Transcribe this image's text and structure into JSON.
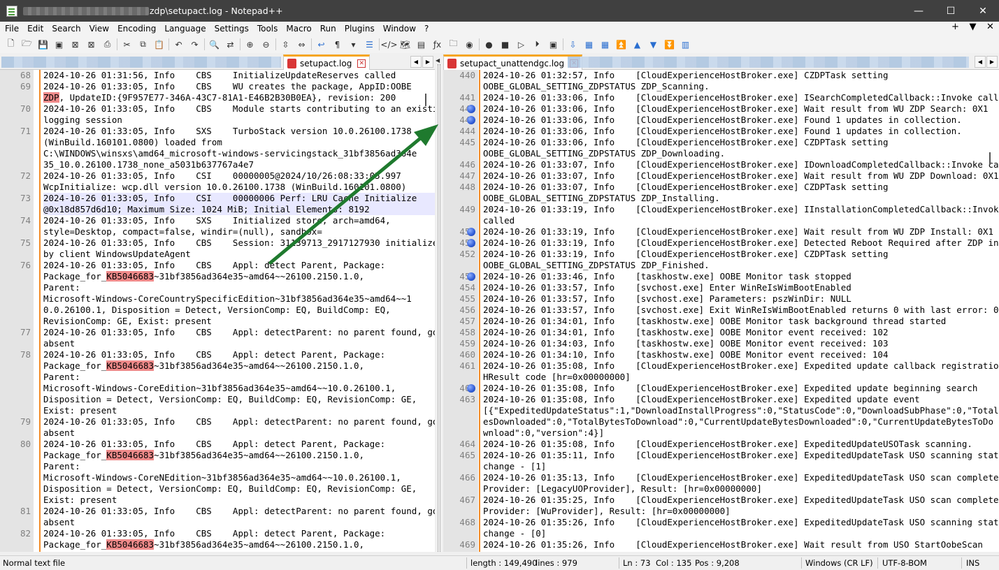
{
  "window": {
    "title": "zdp\\setupact.log - Notepad++",
    "minimize": "—",
    "maximize": "☐",
    "close": "✕"
  },
  "menu": [
    "File",
    "Edit",
    "Search",
    "View",
    "Encoding",
    "Language",
    "Settings",
    "Tools",
    "Macro",
    "Run",
    "Plugins",
    "Window",
    "?"
  ],
  "menu_right": [
    "+",
    "▼",
    "✕"
  ],
  "left_tab": {
    "label": "setupact.log",
    "close": "✕"
  },
  "right_tab": {
    "label": "setupact_unattendgc.log",
    "close": "✕"
  },
  "left_lines": [
    {
      "n": "68",
      "t": "2024-10-26 01:31:56, Info    CBS    InitializeUpdateReserves called"
    },
    {
      "n": "69",
      "t": "2024-10-26 01:33:05, Info    CBS    WU creates the package, AppID:OOBE"
    },
    {
      "n": "",
      "t": "ZDP, UpdateID:{9F957E77-346A-43C7-81A1-E46B2B30B0EA}, revision: 200",
      "hl": "ZDP"
    },
    {
      "n": "70",
      "t": "2024-10-26 01:33:05, Info    CBS    Module starts contributing to an existing"
    },
    {
      "n": "",
      "t": "logging session"
    },
    {
      "n": "71",
      "t": "2024-10-26 01:33:05, Info    SXS    TurboStack version 10.0.26100.1738"
    },
    {
      "n": "",
      "t": "(WinBuild.160101.0800) loaded from"
    },
    {
      "n": "",
      "t": "C:\\WINDOWS\\winsxs\\amd64_microsoft-windows-servicingstack_31bf3856ad364e"
    },
    {
      "n": "",
      "t": "35_10.0.26100.1738_none_a5031b637767a4e7"
    },
    {
      "n": "72",
      "t": "2024-10-26 01:33:05, Info    CSI    00000005@2024/10/26:08:33:05.997"
    },
    {
      "n": "",
      "t": "WcpInitialize: wcp.dll version 10.0.26100.1738 (WinBuild.160101.0800)"
    },
    {
      "n": "73",
      "t": "2024-10-26 01:33:05, Info    CSI    00000006 Perf: LRU Cache Initialize",
      "cur": true
    },
    {
      "n": "",
      "t": "@0x18d857d6d10; Maximum Size: 1024 MiB; Initial Elements: 8192",
      "cur": true
    },
    {
      "n": "74",
      "t": "2024-10-26 01:33:05, Info    SXS    Initialized store, arch=amd64,"
    },
    {
      "n": "",
      "t": "style=Desktop, compact=false, windir=(null), sandbox="
    },
    {
      "n": "75",
      "t": "2024-10-26 01:33:05, Info    CBS    Session: 31139713_2917127930 initialized"
    },
    {
      "n": "",
      "t": "by client WindowsUpdateAgent"
    },
    {
      "n": "76",
      "t": "2024-10-26 01:33:05, Info    CBS    Appl: detect Parent, Package:"
    },
    {
      "n": "",
      "t": "Package_for_KB5046683~31bf3856ad364e35~amd64~~26100.2150.1.0,",
      "hl": "KB5046683"
    },
    {
      "n": "",
      "t": "Parent:"
    },
    {
      "n": "",
      "t": "Microsoft-Windows-CoreCountrySpecificEdition~31bf3856ad364e35~amd64~~1"
    },
    {
      "n": "",
      "t": "0.0.26100.1, Disposition = Detect, VersionComp: EQ, BuildComp: EQ,"
    },
    {
      "n": "",
      "t": "RevisionComp: GE, Exist: present"
    },
    {
      "n": "77",
      "t": "2024-10-26 01:33:05, Info    CBS    Appl: detectParent: no parent found, go"
    },
    {
      "n": "",
      "t": "absent"
    },
    {
      "n": "78",
      "t": "2024-10-26 01:33:05, Info    CBS    Appl: detect Parent, Package:"
    },
    {
      "n": "",
      "t": "Package_for_KB5046683~31bf3856ad364e35~amd64~~26100.2150.1.0,",
      "hl": "KB5046683"
    },
    {
      "n": "",
      "t": "Parent:"
    },
    {
      "n": "",
      "t": "Microsoft-Windows-CoreEdition~31bf3856ad364e35~amd64~~10.0.26100.1,"
    },
    {
      "n": "",
      "t": "Disposition = Detect, VersionComp: EQ, BuildComp: EQ, RevisionComp: GE,"
    },
    {
      "n": "",
      "t": "Exist: present"
    },
    {
      "n": "79",
      "t": "2024-10-26 01:33:05, Info    CBS    Appl: detectParent: no parent found, go"
    },
    {
      "n": "",
      "t": "absent"
    },
    {
      "n": "80",
      "t": "2024-10-26 01:33:05, Info    CBS    Appl: detect Parent, Package:"
    },
    {
      "n": "",
      "t": "Package_for_KB5046683~31bf3856ad364e35~amd64~~26100.2150.1.0,",
      "hl": "KB5046683"
    },
    {
      "n": "",
      "t": "Parent:"
    },
    {
      "n": "",
      "t": "Microsoft-Windows-CoreNEdition~31bf3856ad364e35~amd64~~10.0.26100.1,"
    },
    {
      "n": "",
      "t": "Disposition = Detect, VersionComp: EQ, BuildComp: EQ, RevisionComp: GE,"
    },
    {
      "n": "",
      "t": "Exist: present"
    },
    {
      "n": "81",
      "t": "2024-10-26 01:33:05, Info    CBS    Appl: detectParent: no parent found, go"
    },
    {
      "n": "",
      "t": "absent"
    },
    {
      "n": "82",
      "t": "2024-10-26 01:33:05, Info    CBS    Appl: detect Parent, Package:"
    },
    {
      "n": "",
      "t": "Package_for_KB5046683~31bf3856ad364e35~amd64~~26100.2150.1.0,",
      "hl": "KB5046683"
    }
  ],
  "right_lines": [
    {
      "n": "440",
      "t": "2024-10-26 01:32:57, Info    [CloudExperienceHostBroker.exe] CZDPTask setting"
    },
    {
      "n": "",
      "t": "OOBE_GLOBAL_SETTING_ZDPSTATUS ZDP_Scanning."
    },
    {
      "n": "441",
      "t": "2024-10-26 01:33:06, Info    [CloudExperienceHostBroker.exe] ISearchCompletedCallback::Invoke called"
    },
    {
      "n": "442",
      "t": "2024-10-26 01:33:06, Info    [CloudExperienceHostBroker.exe] Wait result from WU ZDP Search: 0X1",
      "bm": true
    },
    {
      "n": "443",
      "t": "2024-10-26 01:33:06, Info    [CloudExperienceHostBroker.exe] Found 1 updates in collection.",
      "bm": true
    },
    {
      "n": "444",
      "t": "2024-10-26 01:33:06, Info    [CloudExperienceHostBroker.exe] Found 1 updates in collection."
    },
    {
      "n": "445",
      "t": "2024-10-26 01:33:06, Info    [CloudExperienceHostBroker.exe] CZDPTask setting"
    },
    {
      "n": "",
      "t": "OOBE_GLOBAL_SETTING_ZDPSTATUS ZDP_Downloading."
    },
    {
      "n": "446",
      "t": "2024-10-26 01:33:07, Info    [CloudExperienceHostBroker.exe] IDownloadCompletedCallback::Invoke called"
    },
    {
      "n": "447",
      "t": "2024-10-26 01:33:07, Info    [CloudExperienceHostBroker.exe] Wait result from WU ZDP Download: 0X1"
    },
    {
      "n": "448",
      "t": "2024-10-26 01:33:07, Info    [CloudExperienceHostBroker.exe] CZDPTask setting"
    },
    {
      "n": "",
      "t": "OOBE_GLOBAL_SETTING_ZDPSTATUS ZDP_Installing."
    },
    {
      "n": "449",
      "t": "2024-10-26 01:33:19, Info    [CloudExperienceHostBroker.exe] IInstallationCompletedCallback::Invoke"
    },
    {
      "n": "",
      "t": "called"
    },
    {
      "n": "450",
      "t": "2024-10-26 01:33:19, Info    [CloudExperienceHostBroker.exe] Wait result from WU ZDP Install: 0X1",
      "bm": true
    },
    {
      "n": "451",
      "t": "2024-10-26 01:33:19, Info    [CloudExperienceHostBroker.exe] Detected Reboot Required after ZDP install",
      "bm": true
    },
    {
      "n": "452",
      "t": "2024-10-26 01:33:19, Info    [CloudExperienceHostBroker.exe] CZDPTask setting"
    },
    {
      "n": "",
      "t": "OOBE_GLOBAL_SETTING_ZDPSTATUS ZDP_Finished."
    },
    {
      "n": "453",
      "t": "2024-10-26 01:33:46, Info    [taskhostw.exe] OOBE Monitor task stopped",
      "bm": true
    },
    {
      "n": "454",
      "t": "2024-10-26 01:33:57, Info    [svchost.exe] Enter WinReIsWimBootEnabled"
    },
    {
      "n": "455",
      "t": "2024-10-26 01:33:57, Info    [svchost.exe] Parameters: pszWinDir: NULL"
    },
    {
      "n": "456",
      "t": "2024-10-26 01:33:57, Info    [svchost.exe] Exit WinReIsWimBootEnabled returns 0 with last error: 0x2"
    },
    {
      "n": "457",
      "t": "2024-10-26 01:34:01, Info    [taskhostw.exe] OOBE Monitor task background thread started"
    },
    {
      "n": "458",
      "t": "2024-10-26 01:34:01, Info    [taskhostw.exe] OOBE Monitor event received: 102"
    },
    {
      "n": "459",
      "t": "2024-10-26 01:34:03, Info    [taskhostw.exe] OOBE Monitor event received: 103"
    },
    {
      "n": "460",
      "t": "2024-10-26 01:34:10, Info    [taskhostw.exe] OOBE Monitor event received: 104"
    },
    {
      "n": "461",
      "t": "2024-10-26 01:35:08, Info    [CloudExperienceHostBroker.exe] Expedited update callback registration"
    },
    {
      "n": "",
      "t": "HResult code [hr=0x00000000]"
    },
    {
      "n": "462",
      "t": "2024-10-26 01:35:08, Info    [CloudExperienceHostBroker.exe] Expedited update beginning search",
      "bm": true
    },
    {
      "n": "463",
      "t": "2024-10-26 01:35:08, Info    [CloudExperienceHostBroker.exe] Expedited update event"
    },
    {
      "n": "",
      "t": "[{\"ExpeditedUpdateStatus\":1,\"DownloadInstallProgress\":0,\"StatusCode\":0,\"DownloadSubPhase\":0,\"TotalByt"
    },
    {
      "n": "",
      "t": "esDownloaded\":0,\"TotalBytesToDownload\":0,\"CurrentUpdateBytesDownloaded\":0,\"CurrentUpdateBytesToDo"
    },
    {
      "n": "",
      "t": "wnload\":0,\"version\":4}]"
    },
    {
      "n": "464",
      "t": "2024-10-26 01:35:08, Info    [CloudExperienceHostBroker.exe] ExpeditedUpdateUSOTask scanning."
    },
    {
      "n": "465",
      "t": "2024-10-26 01:35:11, Info    [CloudExperienceHostBroker.exe] ExpeditedUpdateTask USO scanning state"
    },
    {
      "n": "",
      "t": "change - [1]"
    },
    {
      "n": "466",
      "t": "2024-10-26 01:35:13, Info    [CloudExperienceHostBroker.exe] ExpeditedUpdateTask USO scan complete -"
    },
    {
      "n": "",
      "t": "Provider: [LegacyUOProvider], Result: [hr=0x00000000]"
    },
    {
      "n": "467",
      "t": "2024-10-26 01:35:25, Info    [CloudExperienceHostBroker.exe] ExpeditedUpdateTask USO scan complete -"
    },
    {
      "n": "",
      "t": "Provider: [WuProvider], Result: [hr=0x00000000]"
    },
    {
      "n": "468",
      "t": "2024-10-26 01:35:26, Info    [CloudExperienceHostBroker.exe] ExpeditedUpdateTask USO scanning state"
    },
    {
      "n": "",
      "t": "change - [0]"
    },
    {
      "n": "469",
      "t": "2024-10-26 01:35:26, Info    [CloudExperienceHostBroker.exe] Wait result from USO StartOobeScan"
    }
  ],
  "status": {
    "type": "Normal text file",
    "length": "length : 149,490",
    "lines": "lines : 979",
    "ln": "Ln : 73",
    "col": "Col : 135",
    "pos": "Pos : 9,208",
    "eol": "Windows (CR LF)",
    "encoding": "UTF-8-BOM",
    "mode": "INS"
  },
  "colors": {
    "accent": "#f28c28",
    "highlight": "#ef8a8a",
    "arrow": "#1f7a2e",
    "bookmark": "#2f5bd6"
  }
}
